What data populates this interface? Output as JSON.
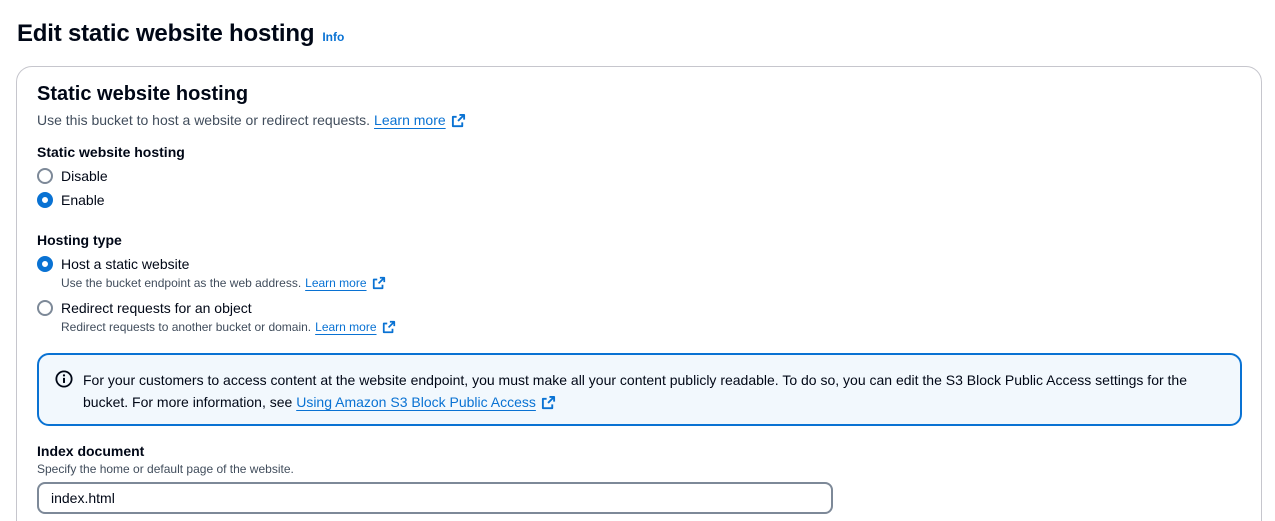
{
  "header": {
    "title": "Edit static website hosting",
    "info_label": "Info"
  },
  "panel": {
    "title": "Static website hosting",
    "description": "Use this bucket to host a website or redirect requests.",
    "learn_more": "Learn more"
  },
  "hosting": {
    "label": "Static website hosting",
    "options": [
      {
        "label": "Disable",
        "checked": false
      },
      {
        "label": "Enable",
        "checked": true
      }
    ]
  },
  "hosting_type": {
    "label": "Hosting type",
    "options": [
      {
        "label": "Host a static website",
        "description": "Use the bucket endpoint as the web address.",
        "learn_more": "Learn more",
        "checked": true
      },
      {
        "label": "Redirect requests for an object",
        "description": "Redirect requests to another bucket or domain.",
        "learn_more": "Learn more",
        "checked": false
      }
    ]
  },
  "alert": {
    "text": "For your customers to access content at the website endpoint, you must make all your content publicly readable. To do so, you can edit the S3 Block Public Access settings for the bucket. For more information, see",
    "link": "Using Amazon S3 Block Public Access"
  },
  "index_document": {
    "label": "Index document",
    "hint": "Specify the home or default page of the website.",
    "value": "index.html"
  },
  "colors": {
    "accent": "#0972d3",
    "alert_bg": "#f2f8fd",
    "text": "#000716",
    "muted": "#414d5c"
  },
  "icons": {
    "external": "external-link-icon",
    "info": "info-circle-icon"
  }
}
